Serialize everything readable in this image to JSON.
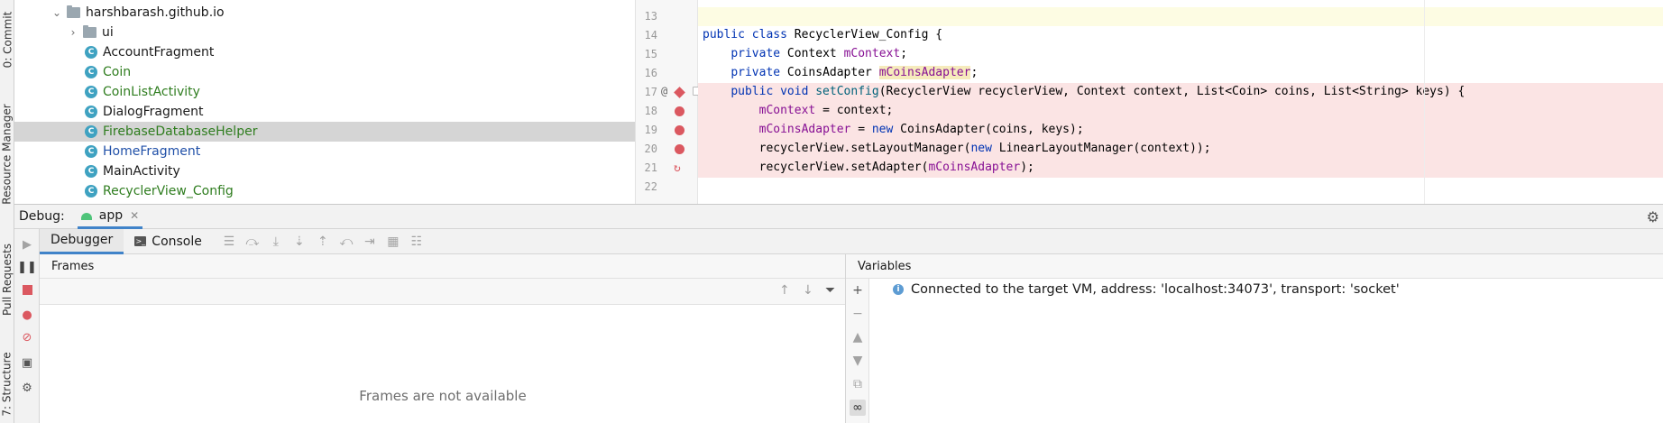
{
  "left_tabs": {
    "commit": "0: Commit",
    "resource_manager": "Resource Manager",
    "pull_requests": "Pull Requests",
    "structure": "7: Structure"
  },
  "project_tree": {
    "root_label": "harshbarash.github.io",
    "items": [
      {
        "label": "ui",
        "kind": "folder",
        "color": "#1a1a1a"
      },
      {
        "label": "AccountFragment",
        "kind": "class",
        "color": "#1a1a1a"
      },
      {
        "label": "Coin",
        "kind": "class",
        "color": "#2f7d1f"
      },
      {
        "label": "CoinListActivity",
        "kind": "class",
        "color": "#2f7d1f"
      },
      {
        "label": "DialogFragment",
        "kind": "class",
        "color": "#1a1a1a"
      },
      {
        "label": "FirebaseDatabaseHelper",
        "kind": "class",
        "color": "#2f7d1f"
      },
      {
        "label": "HomeFragment",
        "kind": "class",
        "color": "#2050a8"
      },
      {
        "label": "MainActivity",
        "kind": "class",
        "color": "#1a1a1a"
      },
      {
        "label": "RecyclerView_Config",
        "kind": "class",
        "color": "#2f7d1f"
      }
    ]
  },
  "editor": {
    "line_numbers": [
      "13",
      "14",
      "15",
      "16",
      "17",
      "18",
      "19",
      "20",
      "21",
      "22"
    ],
    "gutter_at": "@",
    "code": {
      "line14_kw": "public class",
      "line14_rest": " RecyclerView_Config {",
      "line15_kw": "private",
      "line15_type": " Context ",
      "line15_field": "mContext",
      "line15_end": ";",
      "line16_kw": "private",
      "line16_type": " CoinsAdapter ",
      "line16_field": "mCoinsAdapter",
      "line16_end": ";",
      "line17_kw": "public void",
      "line17_fn": "setConfig",
      "line17_rest": "(RecyclerView recyclerView, Context context, List<Coin> coins, List<String> keys) {",
      "line18_field": "mContext",
      "line18_rest": " = context;",
      "line19_field": "mCoinsAdapter",
      "line19_mid": " = ",
      "line19_kw": "new",
      "line19_rest": " CoinsAdapter(coins, keys);",
      "line20_a": "recyclerView.setLayoutManager(",
      "line20_kw": "new",
      "line20_b": " LinearLayoutManager(context));",
      "line21_a": "recyclerView.setAdapter(",
      "line21_field": "mCoinsAdapter",
      "line21_b": ");"
    }
  },
  "debug": {
    "label": "Debug:",
    "app_tab": "app",
    "tabs": {
      "debugger": "Debugger",
      "console": "Console"
    },
    "frames": {
      "title": "Frames",
      "empty_text": "Frames are not available"
    },
    "variables": {
      "title": "Variables",
      "message": "Connected to the target VM, address: 'localhost:34073', transport: 'socket'"
    }
  },
  "colors": {
    "accent": "#4083c9",
    "breakpoint": "#db5860",
    "breakpoint_line_bg": "#fbe4e4",
    "caret_line_bg": "#fdfce3",
    "selection_bg": "#d5d5d5"
  }
}
